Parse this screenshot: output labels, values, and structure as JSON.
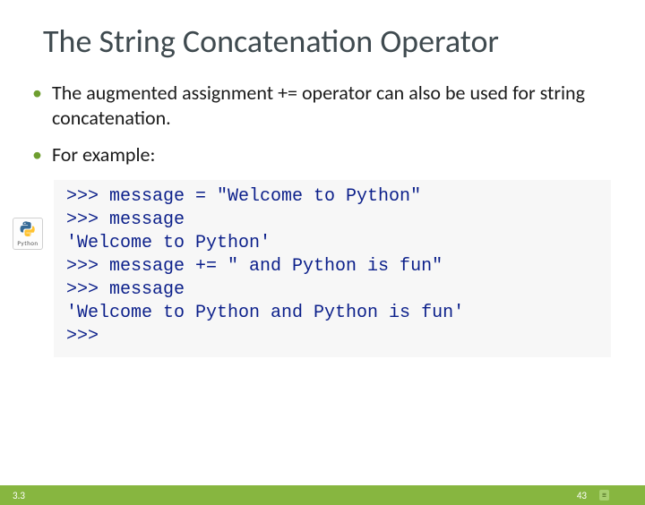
{
  "title": "The String Concatenation Operator",
  "bullets": [
    "The augmented assignment += operator can also be used for string concatenation.",
    "For example:"
  ],
  "icon_caption": "Python",
  "code": ">>> message = \"Welcome to Python\"\n>>> message\n'Welcome to Python'\n>>> message += \" and Python is fun\"\n>>> message\n'Welcome to Python and Python is fun'\n>>> ",
  "footer": {
    "section": "3.3",
    "page": "43",
    "license": "≡"
  }
}
